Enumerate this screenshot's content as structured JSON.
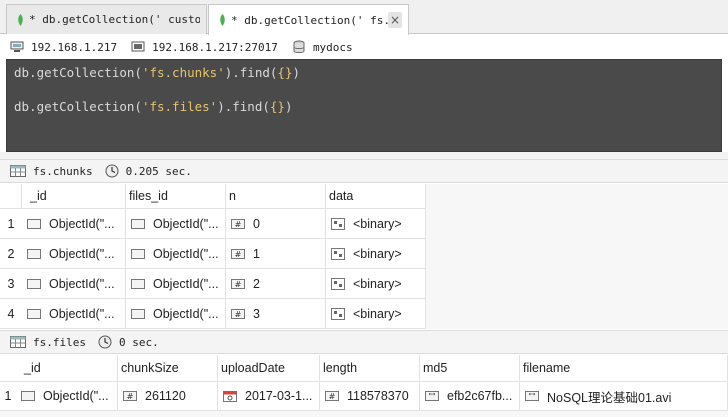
{
  "tabs": [
    {
      "title": "* db.getCollection(' custo…",
      "active": false
    },
    {
      "title": "* db.getCollection(' fs.ch…",
      "active": true
    }
  ],
  "tab_close_glyph": "×",
  "connection": {
    "host": "192.168.1.217",
    "server": "192.168.1.217:27017",
    "database": "mydocs"
  },
  "editor": {
    "line1": {
      "pre": "db.getCollection(",
      "str": "'fs.chunks'",
      "mid": ").find(",
      "brace": "{}",
      "post": ")"
    },
    "line2": {
      "pre": "db.getCollection(",
      "str": "'fs.files'",
      "mid": ").find(",
      "brace": "{}",
      "post": ")"
    }
  },
  "result_chunks": {
    "collection": "fs.chunks",
    "time": "0.205 sec.",
    "columns": [
      "_id",
      "files_id",
      "n",
      "data"
    ],
    "rows": [
      {
        "num": "1",
        "id": "ObjectId(\"...",
        "files_id": "ObjectId(\"...",
        "n": "0",
        "data": "<binary>"
      },
      {
        "num": "2",
        "id": "ObjectId(\"...",
        "files_id": "ObjectId(\"...",
        "n": "1",
        "data": "<binary>"
      },
      {
        "num": "3",
        "id": "ObjectId(\"...",
        "files_id": "ObjectId(\"...",
        "n": "2",
        "data": "<binary>"
      },
      {
        "num": "4",
        "id": "ObjectId(\"...",
        "files_id": "ObjectId(\"...",
        "n": "3",
        "data": "<binary>"
      }
    ]
  },
  "result_files": {
    "collection": "fs.files",
    "time": "0 sec.",
    "columns": [
      "_id",
      "chunkSize",
      "uploadDate",
      "length",
      "md5",
      "filename"
    ],
    "rows": [
      {
        "num": "1",
        "id": "ObjectId(\"...",
        "chunkSize": "261120",
        "uploadDate": "2017-03-1...",
        "length": "118578370",
        "md5": "efb2c67fb...",
        "filename": "NoSQL理论基础01.avi"
      }
    ]
  },
  "colors": {
    "editor_bg": "#4a4a4a",
    "code_plain": "#d9d9d9",
    "code_string": "#e7c46a",
    "mongo_leaf": "#4caf50"
  }
}
